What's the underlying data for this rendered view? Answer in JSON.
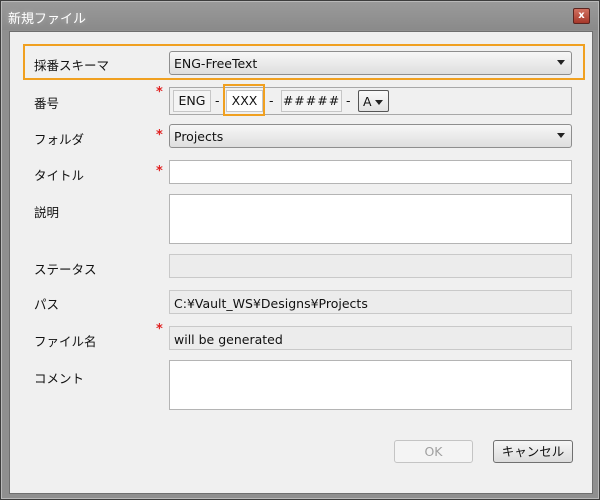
{
  "window": {
    "title": "新規ファイル",
    "close_glyph": "x"
  },
  "form": {
    "scheme": {
      "label": "採番スキーマ",
      "value": "ENG-FreeText",
      "required": false
    },
    "number": {
      "label": "番号",
      "required_mark": "*",
      "segments": [
        "ENG",
        "-",
        "XXX",
        "-",
        "#####",
        "-"
      ],
      "suffix_value": "A"
    },
    "folder": {
      "label": "フォルダ",
      "required_mark": "*",
      "value": "Projects"
    },
    "title": {
      "label": "タイトル",
      "required_mark": "*",
      "value": ""
    },
    "description": {
      "label": "説明",
      "value": ""
    },
    "status": {
      "label": "ステータス",
      "value": ""
    },
    "path": {
      "label": "パス",
      "value": "C:¥Vault_WS¥Designs¥Projects"
    },
    "filename": {
      "label": "ファイル名",
      "required_mark": "*",
      "value": "will be generated"
    },
    "comment": {
      "label": "コメント",
      "value": ""
    }
  },
  "buttons": {
    "ok": {
      "label": "OK",
      "enabled": false
    },
    "cancel": {
      "label": "キャンセル",
      "enabled": true
    }
  },
  "colors": {
    "highlight": "#f0a020",
    "required": "#e02020"
  }
}
